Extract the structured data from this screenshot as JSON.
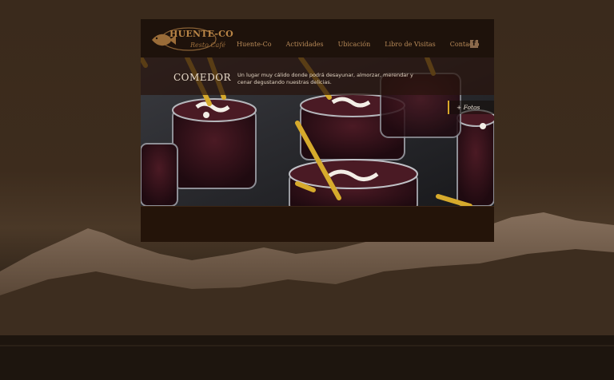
{
  "header": {
    "logo_text": "HUENTE-CO",
    "logo_subtext": "Resto Café"
  },
  "nav": {
    "items": [
      "Huente-Co",
      "Actividades",
      "Ubicación",
      "Libro de Visitas",
      "Contacto"
    ]
  },
  "social": {
    "facebook_glyph": "f"
  },
  "section": {
    "title": "COMEDOR",
    "description": "Un lugar muy cálido donde podrá desayunar, almorzar, merendar y cenar degustando nuestras delicias."
  },
  "gallery_link": "+ Fotos",
  "colors": {
    "accent": "#d9a82a",
    "nav_text": "#b88a58",
    "panel_bg": "#1c110a"
  }
}
